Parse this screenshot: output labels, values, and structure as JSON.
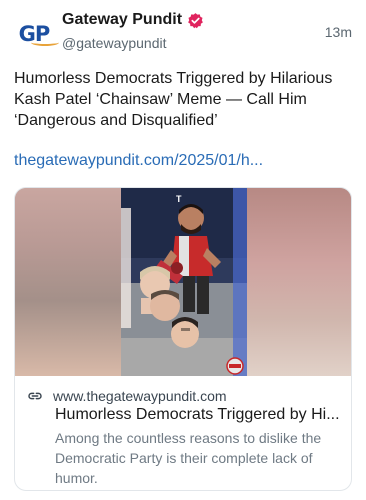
{
  "author": {
    "avatar_text": "GP",
    "display_name": "Gateway Pundit",
    "handle": "@gatewaypundit",
    "verified_icon": "verified-badge-icon",
    "verified_color": "#e0245e"
  },
  "post": {
    "time": "13m",
    "text": "Humorless Democrats Triggered by Hilarious Kash Patel ‘Chainsaw’ Meme — Call Him ‘Dangerous and Disqualified’",
    "link": "thegatewaypundit.com/2025/01/h..."
  },
  "card": {
    "domain": "www.thegatewaypundit.com",
    "title": "Humorless Democrats Triggered by Hi...",
    "description": "Among the countless reasons to dislike the Democratic Party is their complete lack of humor.",
    "link_icon": "link-icon"
  },
  "colors": {
    "link": "#2a6cb6",
    "brand_blue": "#1c4fa0",
    "brand_orange": "#e8a33a"
  }
}
